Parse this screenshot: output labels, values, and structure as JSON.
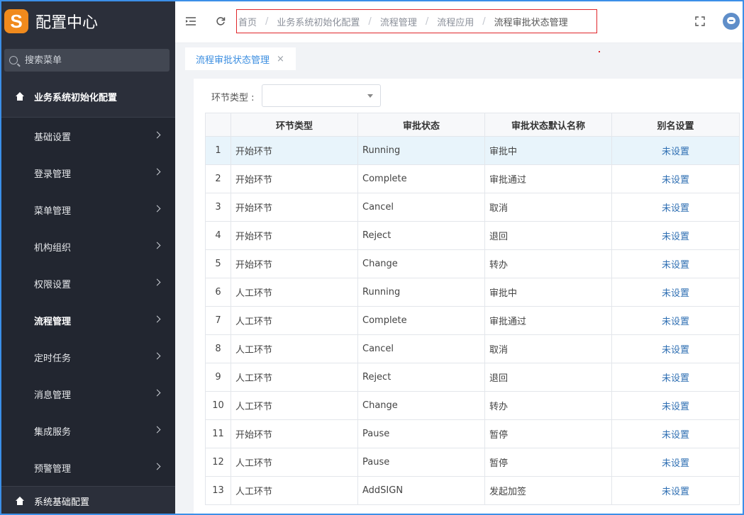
{
  "app": {
    "logo_letter": "S",
    "title": "配置中心"
  },
  "sidebar": {
    "search_placeholder": "搜索菜单",
    "group1": "业务系统初始化配置",
    "items": [
      {
        "label": "基础设置",
        "active": false
      },
      {
        "label": "登录管理",
        "active": false
      },
      {
        "label": "菜单管理",
        "active": false
      },
      {
        "label": "机构组织",
        "active": false
      },
      {
        "label": "权限设置",
        "active": false
      },
      {
        "label": "流程管理",
        "active": true
      },
      {
        "label": "定时任务",
        "active": false
      },
      {
        "label": "消息管理",
        "active": false
      },
      {
        "label": "集成服务",
        "active": false
      },
      {
        "label": "预警管理",
        "active": false
      }
    ],
    "group2": "系统基础配置"
  },
  "topbar": {
    "breadcrumbs": [
      "首页",
      "业务系统初始化配置",
      "流程管理",
      "流程应用",
      "流程审批状态管理"
    ],
    "separator": "/",
    "menu_icon": "menu-fold-icon",
    "refresh_icon": "refresh-icon",
    "fullscreen_icon": "fullscreen-icon"
  },
  "tabs": [
    {
      "label": "流程审批状态管理",
      "close": "×"
    }
  ],
  "filter": {
    "label": "环节类型 :",
    "value": ""
  },
  "table": {
    "columns": [
      "",
      "环节类型",
      "审批状态",
      "审批状态默认名称",
      "别名设置"
    ],
    "rows": [
      [
        "1",
        "开始环节",
        "Running",
        "审批中",
        "未设置"
      ],
      [
        "2",
        "开始环节",
        "Complete",
        "审批通过",
        "未设置"
      ],
      [
        "3",
        "开始环节",
        "Cancel",
        "取消",
        "未设置"
      ],
      [
        "4",
        "开始环节",
        "Reject",
        "退回",
        "未设置"
      ],
      [
        "5",
        "开始环节",
        "Change",
        "转办",
        "未设置"
      ],
      [
        "6",
        "人工环节",
        "Running",
        "审批中",
        "未设置"
      ],
      [
        "7",
        "人工环节",
        "Complete",
        "审批通过",
        "未设置"
      ],
      [
        "8",
        "人工环节",
        "Cancel",
        "取消",
        "未设置"
      ],
      [
        "9",
        "人工环节",
        "Reject",
        "退回",
        "未设置"
      ],
      [
        "10",
        "人工环节",
        "Change",
        "转办",
        "未设置"
      ],
      [
        "11",
        "开始环节",
        "Pause",
        "暂停",
        "未设置"
      ],
      [
        "12",
        "人工环节",
        "Pause",
        "暂停",
        "未设置"
      ],
      [
        "13",
        "人工环节",
        "AddSIGN",
        "发起加签",
        "未设置"
      ]
    ]
  },
  "colors": {
    "sidebar_bg": "#2b2f3a",
    "accent": "#3a8de0",
    "logo": "#f08a1d",
    "link": "#2f6fb3",
    "highlight": "#e0262b"
  }
}
